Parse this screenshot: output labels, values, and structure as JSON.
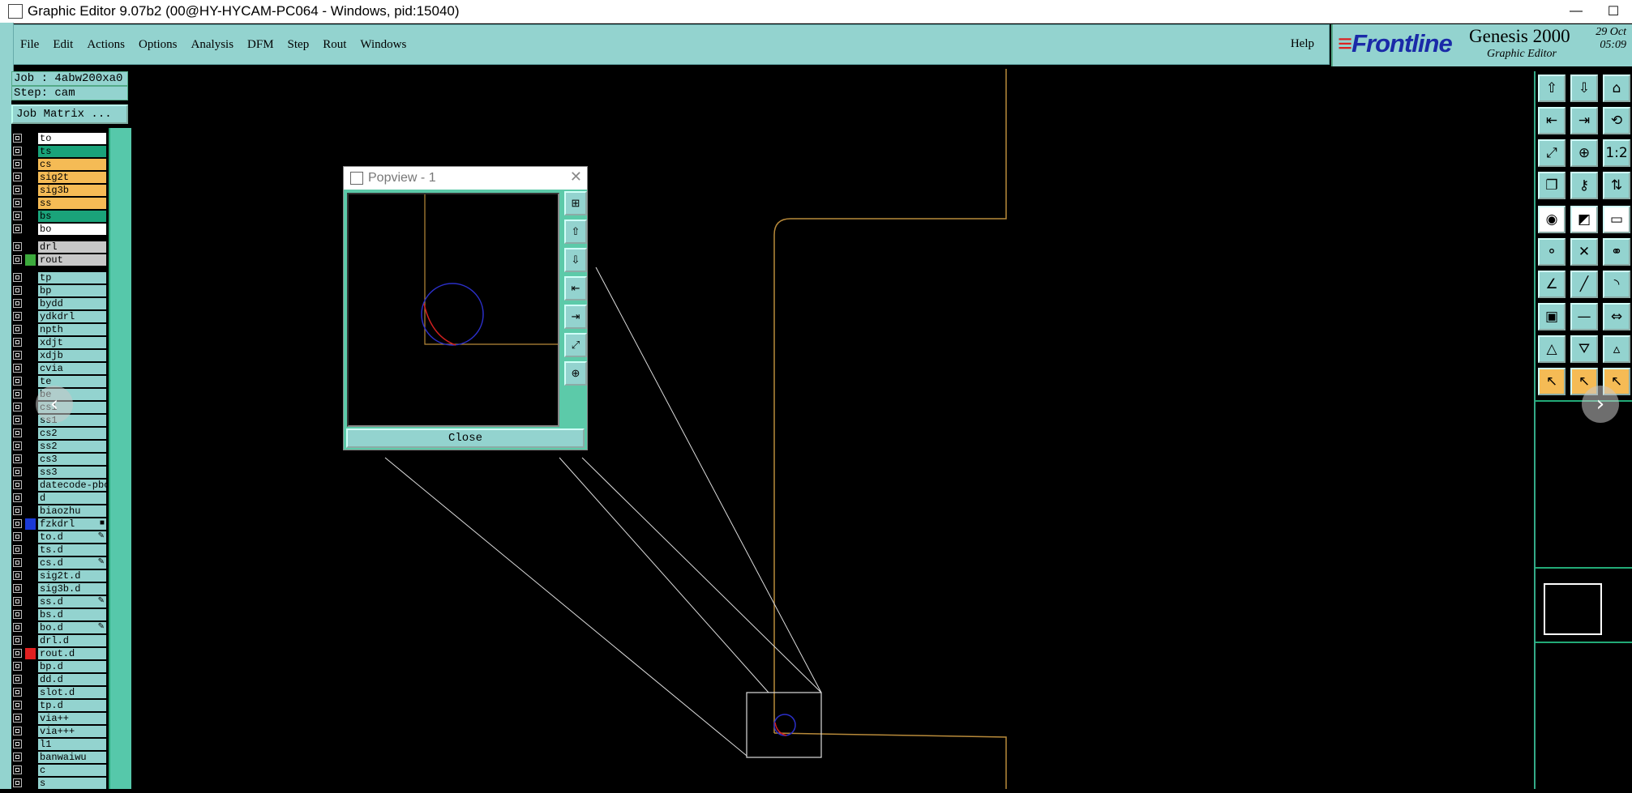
{
  "window": {
    "title": "Graphic Editor 9.07b2 (00@HY-HYCAM-PC064 - Windows, pid:15040)",
    "minimize": "—",
    "maximize": "☐"
  },
  "menu": {
    "items": [
      "File",
      "Edit",
      "Actions",
      "Options",
      "Analysis",
      "DFM",
      "Step",
      "Rout",
      "Windows"
    ],
    "help": "Help"
  },
  "brand": {
    "logo": "Frontline",
    "product": "Genesis 2000",
    "subtitle": "Graphic Editor",
    "date": "29 Oct",
    "time": "05:09"
  },
  "job": {
    "job": "Job : 4abw200xa0",
    "step": "Step: cam",
    "matrix_button": "Job Matrix ..."
  },
  "layers": [
    {
      "name": "to",
      "color": "#ffffff"
    },
    {
      "name": "ts",
      "color": "#1aa37a"
    },
    {
      "name": "cs",
      "color": "#f5bb55"
    },
    {
      "name": "sig2t",
      "color": "#f5bb55"
    },
    {
      "name": "sig3b",
      "color": "#f5bb55"
    },
    {
      "name": "ss",
      "color": "#f5bb55"
    },
    {
      "name": "bs",
      "color": "#1aa37a"
    },
    {
      "name": "bo",
      "color": "#ffffff"
    },
    {
      "name": "drl",
      "color": "#c8c8c8"
    },
    {
      "name": "rout",
      "color": "#c8c8c8",
      "swatch": "#3caa3c"
    },
    {
      "name": "tp"
    },
    {
      "name": "bp"
    },
    {
      "name": "bydd"
    },
    {
      "name": "ydkdrl"
    },
    {
      "name": "npth"
    },
    {
      "name": "xdjt"
    },
    {
      "name": "xdjb"
    },
    {
      "name": "cvia"
    },
    {
      "name": "te"
    },
    {
      "name": "be"
    },
    {
      "name": "cs1"
    },
    {
      "name": "ss1"
    },
    {
      "name": "cs2"
    },
    {
      "name": "ss2"
    },
    {
      "name": "cs3"
    },
    {
      "name": "ss3"
    },
    {
      "name": "datecode-pbc"
    },
    {
      "name": "d"
    },
    {
      "name": "biaozhu"
    },
    {
      "name": "fzkdrl",
      "swatch": "#1a3ad8",
      "mark": "■"
    },
    {
      "name": "to.d",
      "mark": "✎"
    },
    {
      "name": "ts.d"
    },
    {
      "name": "cs.d",
      "mark": "✎"
    },
    {
      "name": "sig2t.d"
    },
    {
      "name": "sig3b.d"
    },
    {
      "name": "ss.d",
      "mark": "✎"
    },
    {
      "name": "bs.d"
    },
    {
      "name": "bo.d",
      "mark": "✎"
    },
    {
      "name": "drl.d"
    },
    {
      "name": "rout.d",
      "swatch": "#e02020"
    },
    {
      "name": "bp.d"
    },
    {
      "name": "dd.d"
    },
    {
      "name": "slot.d"
    },
    {
      "name": "tp.d"
    },
    {
      "name": "via++"
    },
    {
      "name": "via+++"
    },
    {
      "name": "l1"
    },
    {
      "name": "banwaiwu"
    },
    {
      "name": "c"
    },
    {
      "name": "s"
    }
  ],
  "popview": {
    "title": "Popview - 1",
    "close_x": "✕",
    "close_button": "Close"
  },
  "tools": [
    {
      "icon": "upload-icon",
      "glyph": "⇧"
    },
    {
      "icon": "download-icon",
      "glyph": "⇩"
    },
    {
      "icon": "home-icon",
      "glyph": "⌂"
    },
    {
      "icon": "move-left-icon",
      "glyph": "⇤"
    },
    {
      "icon": "move-right-icon",
      "glyph": "⇥"
    },
    {
      "icon": "rotate-icon",
      "glyph": "⟲"
    },
    {
      "icon": "zoom-fit-icon",
      "glyph": "⤢"
    },
    {
      "icon": "zoom-center-icon",
      "glyph": "⊕"
    },
    {
      "icon": "ratio-icon",
      "glyph": "1:2"
    },
    {
      "icon": "snapshot-icon",
      "glyph": "❐"
    },
    {
      "icon": "key-icon",
      "glyph": "⚷"
    },
    {
      "icon": "layer-arrows-icon",
      "glyph": "⇅"
    },
    {
      "icon": "pad-icon",
      "glyph": "◉",
      "style": "w"
    },
    {
      "icon": "edge-icon",
      "glyph": "◩",
      "style": "w"
    },
    {
      "icon": "ruler-icon",
      "glyph": "▭",
      "style": "w"
    },
    {
      "icon": "connect-icon",
      "glyph": "⚬"
    },
    {
      "icon": "cross-icon",
      "glyph": "✕"
    },
    {
      "icon": "link-icon",
      "glyph": "⚭"
    },
    {
      "icon": "angle-icon",
      "glyph": "∠"
    },
    {
      "icon": "line-icon",
      "glyph": "╱"
    },
    {
      "icon": "arc-icon",
      "glyph": "◝"
    },
    {
      "icon": "snap-icon",
      "glyph": "▣"
    },
    {
      "icon": "dash-icon",
      "glyph": "—"
    },
    {
      "icon": "measure-icon",
      "glyph": "⇔"
    },
    {
      "icon": "triangle-icon",
      "glyph": "△"
    },
    {
      "icon": "arc-triangle-icon",
      "glyph": "⛛"
    },
    {
      "icon": "triangle-alt-icon",
      "glyph": "▵"
    },
    {
      "icon": "pointer-icon",
      "glyph": "↖",
      "style": "o"
    },
    {
      "icon": "pointer-select-icon",
      "glyph": "↖",
      "style": "o"
    },
    {
      "icon": "pointer-multi-icon",
      "glyph": "↖",
      "style": "o"
    }
  ],
  "nav": {
    "prev": "‹",
    "next": "›"
  }
}
